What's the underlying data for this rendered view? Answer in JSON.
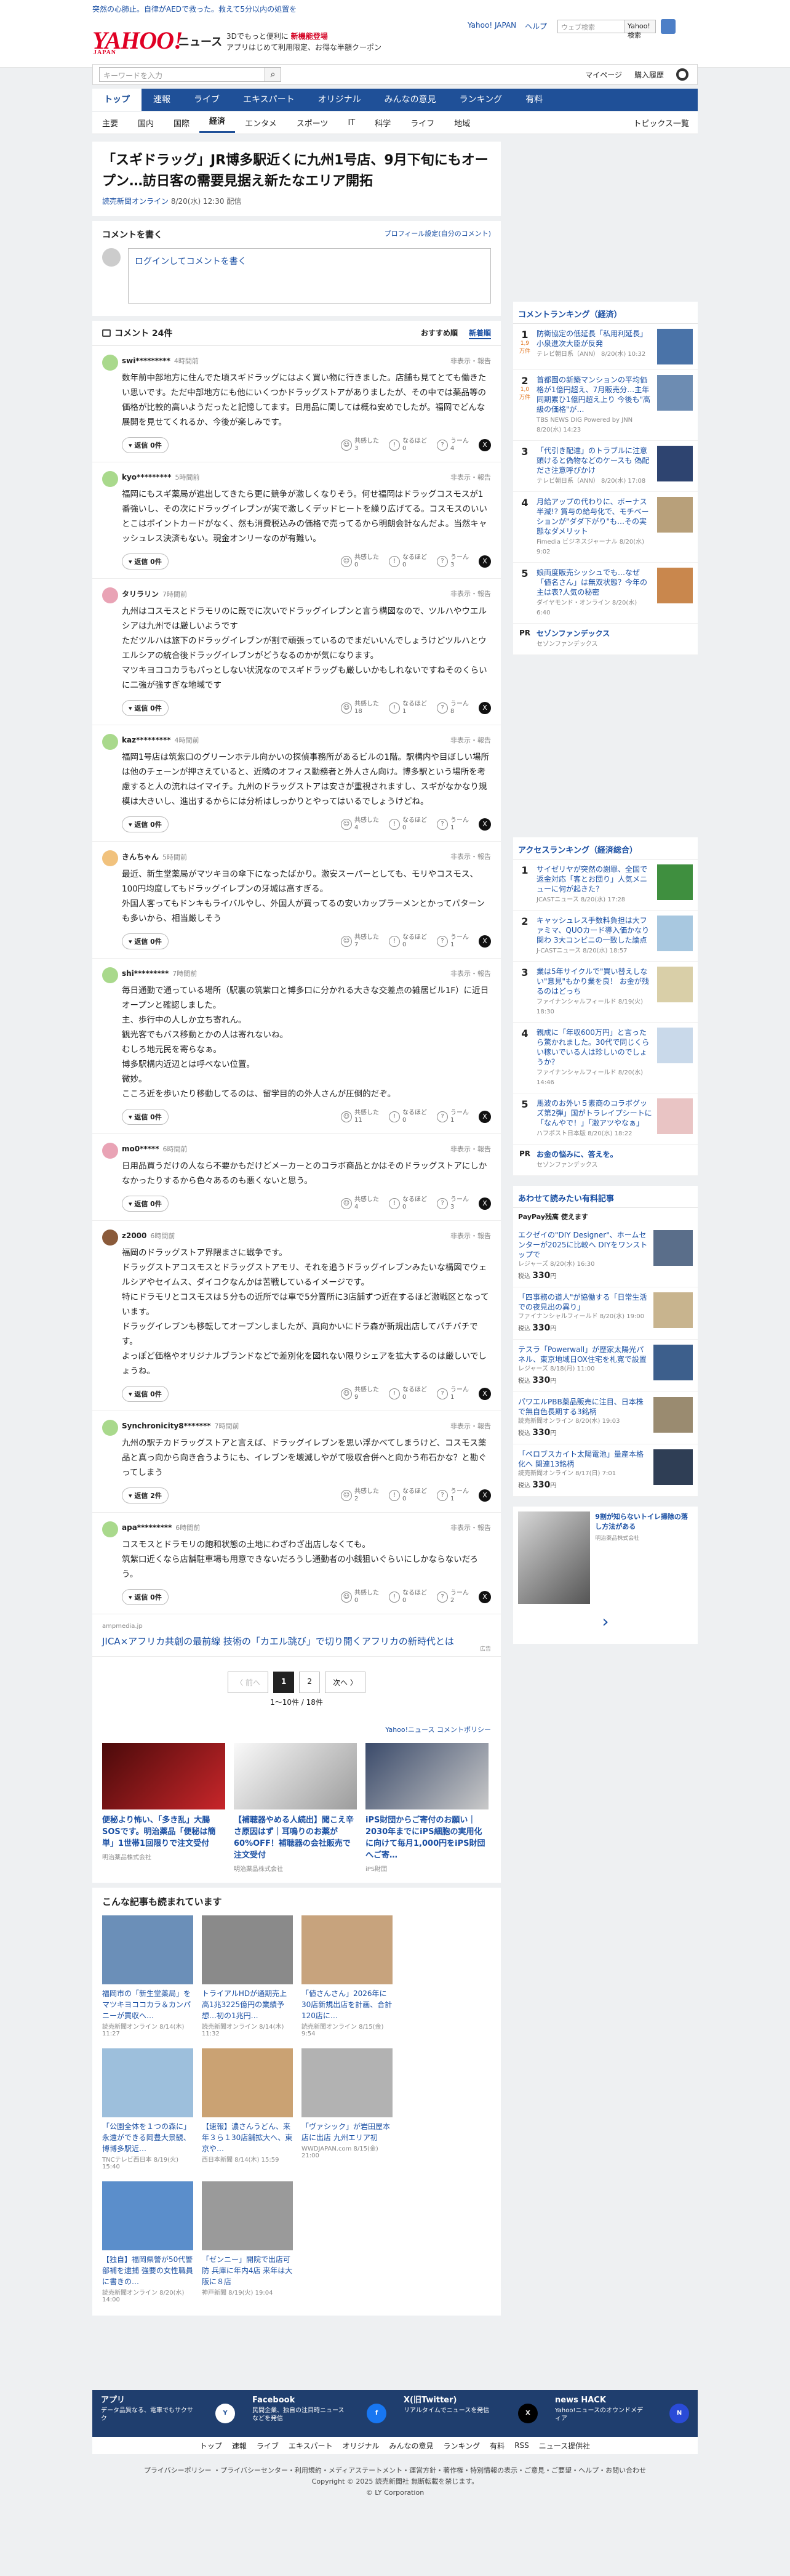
{
  "header": {
    "promo": "突然の心肺止。自律がAEDで救った。救えて5分以内の処置を",
    "logo": "YAHOO!",
    "logo_sub": "JAPAN",
    "logo_news": "ニュース",
    "tagline1": "3Dでもっと便利に",
    "tagline1b": "新機能登場",
    "tagline2": "アプリはじめて利用限定、お得な半額クーポン",
    "links": [
      "Yahoo! JAPAN",
      "ヘルプ"
    ],
    "search_placeholder": "ウェブ検索",
    "search_button": "Yahoo! 検索",
    "site_search_placeholder": "キーワードを入力",
    "mypage": "マイページ",
    "history": "購入履歴"
  },
  "nav": {
    "main": [
      "トップ",
      "速報",
      "ライブ",
      "エキスパート",
      "オリジナル",
      "みんなの意見",
      "ランキング",
      "有料"
    ],
    "active": 0,
    "sub": [
      "主要",
      "国内",
      "国際",
      "経済",
      "エンタメ",
      "スポーツ",
      "IT",
      "科学",
      "ライフ",
      "地域"
    ],
    "sub_active": 3,
    "sub_right": "トピックス一覧"
  },
  "article": {
    "title": "「スギドラッグ」JR博多駅近くに九州1号店、9月下旬にもオープン…訪日客の需要見据え新たなエリア開拓",
    "source": "読売新聞オンライン",
    "date": "8/20(水) 12:30 配信"
  },
  "comment_write": {
    "title": "コメントを書く",
    "profile_link": "プロフィール設定(自分のコメント)",
    "placeholder": "ログインしてコメントを書く"
  },
  "comments_header": {
    "count": "コメント 24件",
    "sort_recommend": "おすすめ順",
    "sort_new": "新着順"
  },
  "comments": [
    {
      "user": "swi*********",
      "time": "4時間前",
      "report": "非表示・報告",
      "avatar": "#a9d98c",
      "text": "数年前中部地方に住んでた頃スギドラッグにはよく買い物に行きました。店舗も見てとても働きたい思いです。ただ中部地方にも他にいくつかドラッグストアがありましたが、その中では薬品等の価格が比較的高いようだったと記憶してます。日用品に関しては概ね安めでしたが。福岡でどんな展開を見せてくれるか、今後が楽しみです。",
      "reply": "返信 0件",
      "v1": "3",
      "v2": "0",
      "v3": "4"
    },
    {
      "user": "kyo*********",
      "time": "5時間前",
      "report": "非表示・報告",
      "avatar": "#a9d98c",
      "text": "福岡にもスギ薬局が進出してきたら更に競争が激しくなりそう。何せ福岡はドラッグコスモスが1番強いし、その次にドラッグイレブンが実で激しくデッドヒートを繰り広げてる。コスモスのいいとこはポイントカードがなく、然も消費税込みの価格で売ってるから明朗会計なんだよ。当然キャッシュレス決済もない。現金オンリーなのが有難い。",
      "reply": "返信 0件",
      "v1": "0",
      "v2": "0",
      "v3": "3"
    },
    {
      "user": "タリラリン",
      "time": "7時間前",
      "report": "非表示・報告",
      "avatar": "#e9a3b5",
      "text": "九州はコスモスとドラモリのに既でに次いでドラッグイレブンと言う構図なので、ツルハやウエルシアは九州では厳しいようです\nただツルハは旅下のドラッグイレブンが割で頑張っているのでまだいいんでしょうけどツルハとウエルシアの統合後ドラッグイレブンがどうなるのかが気になります。\nマツキヨココカラもパっとしない状況なのでスギドラッグも厳しいかもしれないですねそのくらいに二強が強すぎな地域です",
      "reply": "返信 0件",
      "v1": "18",
      "v2": "1",
      "v3": "8"
    },
    {
      "user": "kaz*********",
      "time": "4時間前",
      "report": "非表示・報告",
      "avatar": "#a9d98c",
      "text": "福岡1号店は筑紫口のグリーンホテル向かいの探偵事務所があるビルの1階。駅構内や目ぼしい場所は他のチェーンが押さえていると、近隣のオフィス勤務者と外人さん向け。博多駅という場所を考慮すると人の流れはイマイチ。九州のドラッグストアは安さが重視されますし、スギがなかなり規模は大きいし、進出するからには分析はしっかりとやってはいるでしょうけどね。",
      "reply": "返信 0件",
      "v1": "4",
      "v2": "0",
      "v3": "1"
    },
    {
      "user": "きんちゃん",
      "time": "5時間前",
      "report": "非表示・報告",
      "avatar": "#f1c27d",
      "text": "最近、新生堂薬局がマツキヨの傘下になったばかり。激安スーパーとしても、モリやコスモス、100円均度してもドラッグイレブンの牙城は高すぎる。\n外国人客ってもドンキもライバルやし、外国人が買ってるの安いカップラーメンとかってパターンも多いから、相当厳しそう",
      "reply": "返信 0件",
      "v1": "7",
      "v2": "0",
      "v3": "1"
    },
    {
      "user": "shi*********",
      "time": "7時間前",
      "report": "非表示・報告",
      "avatar": "#a9d98c",
      "text": "毎日通勤で通っている場所（駅裏の筑紫口と博多口に分かれる大きな交差点の雑居ビル1F）に近日オープンと確認しました。\n主、歩行中の人しか立ち寄れん。\n観光客でもバス移動とかの人は寄れないね。\nむしろ地元民を寄らなぁ。\n博多駅構内近辺とは呼べない位置。\n微妙。\nこころ近を歩いたり移動してるのは、留学目的の外人さんが圧倒的だぞ。",
      "reply": "返信 0件",
      "v1": "11",
      "v2": "0",
      "v3": "1"
    },
    {
      "user": "mo0*****",
      "time": "6時間前",
      "report": "非表示・報告",
      "avatar": "#e9a3b5",
      "text": "日用品買うだけの人なら不要かもだけどメーカーとのコラボ商品とかはそのドラッグストアにしかなかったりするから色々あるのも悪くないと思う。",
      "reply": "返信 0件",
      "v1": "4",
      "v2": "0",
      "v3": "3"
    },
    {
      "user": "z2000",
      "time": "6時間前",
      "report": "非表示・報告",
      "avatar": "#8a5a3a",
      "text": "福岡のドラッグストア界隈まさに戦争です。\nドラッグストアコスモスとドラッグストアモリ、それを追うドラッグイレブンみたいな構図でウェルシアやセイムス、ダイコクなんかは苦戦しているイメージです。\n特にドラモリとコスモスは５分もの近所では車で5分置所に3店舗ずつ近在するほど激戦区となっています。\nドラッグイレブンも移転してオープンしましたが、真向かいにドラ森が新規出店してバチバチです。\nよっぽど価格やオリジナルブランドなどで差別化を図れない限りシェアを拡大するのは厳しいでしょうね。",
      "reply": "返信 0件",
      "v1": "9",
      "v2": "0",
      "v3": "1"
    },
    {
      "user": "Synchronicity8*******",
      "time": "7時間前",
      "report": "非表示・報告",
      "avatar": "#a9d98c",
      "text": "九州の駅チカドラッグストアと言えば、ドラッグイレブンを思い浮かべてしまうけど、コスモス薬品と真っ向から向き合うようにも、イレブンを壊滅しやがて吸収合併へと向かう布石かな？と勘ぐってしまう",
      "reply": "返信 2件",
      "v1": "2",
      "v2": "0",
      "v3": "1"
    },
    {
      "user": "apa*********",
      "time": "6時間前",
      "report": "非表示・報告",
      "avatar": "#a9d98c",
      "text": "コスモスとドラモリの飽和状態の土地にわざわざ出店しなくても。\n筑紫口近くなら店舗駐車場も用意できないだろうし通勤者の小銭狙いぐらいにしかならないだろう。",
      "reply": "返信 0件",
      "v1": "0",
      "v2": "0",
      "v3": "2"
    }
  ],
  "comment_ad": {
    "domain": "ampmedia.jp",
    "text": "JICA×アフリカ共創の最前線 技術の「カエル跳び」で切り開くアフリカの新時代とは",
    "label": "広告"
  },
  "pagination": {
    "prev": "〈 前へ",
    "pages": [
      "1",
      "2"
    ],
    "next": "次へ 〉",
    "count": "1〜10件 / 18件"
  },
  "policy": "Yahoo!ニュース コメントポリシー",
  "sponsored": [
    {
      "title": "便秘より怖い、「多き乱」大腸SOSです。明治薬品「便秘は簡単」1世帯1回限りで注文受付",
      "source": "明治薬品株式会社"
    },
    {
      "title": "【補聴器やめる人続出】聞こえ辛さ原因はず｜耳鳴りのお薬が60%OFF！補聴器の会社販売で注文受付",
      "source": "明治薬品株式会社"
    },
    {
      "title": "iPS財団からご寄付のお願い｜2030年までにiPS細胞の実用化に向けて毎月1,000円をiPS財団へご寄…",
      "source": "iPS財団"
    }
  ],
  "recommend": {
    "title": "こんな記事も読まれています",
    "items": [
      {
        "title": "福岡市の「新生堂薬局」をマツキヨココカラ＆カンパニーが買収へ…",
        "source": "読売新聞オンライン",
        "date": "8/14(木) 11:27"
      },
      {
        "title": "トライアルHDが通期売上高1兆3225億円の業績予想…初の1兆円…",
        "source": "読売新聞オンライン",
        "date": "8/14(木) 11:32"
      },
      {
        "title": "「値さんさん」2026年に30店新規出店を計画、合計120店に…",
        "source": "読売新聞オンライン",
        "date": "8/15(金) 9:54"
      },
      {
        "title": "「公園全体を１つの森に」永遠ができる岡豊大景観、博博多駅近…",
        "source": "TNCテレビ西日本",
        "date": "8/19(火) 15:40"
      },
      {
        "title": "【速報】濃さんうどん、来年３ら１30店舗拡大へ、東京や…",
        "source": "西日本新聞",
        "date": "8/14(木) 15:59"
      },
      {
        "title": "「ヴァシック」が岩田屋本店に出店 九州エリア初",
        "source": "WWDJAPAN.com",
        "date": "8/15(金) 21:00"
      },
      {
        "title": "【独自】福岡県警が50代警部補を逮捕 強要の女性職員に書きの…",
        "source": "読売新聞オンライン",
        "date": "8/20(水) 14:00"
      },
      {
        "title": "「ゼンニー」開院で出店可防 兵庫に年内4店 来年は大阪に８店",
        "source": "神戸新聞",
        "date": "8/19(火) 19:04"
      }
    ]
  },
  "side_comment_ranking": {
    "title": "コメントランキング（経済）",
    "items": [
      {
        "rank": "1",
        "count": "1,9万件",
        "title": "防衛協定の低延長「私用利延長」小泉進次大臣が反発",
        "source": "テレビ朝日系（ANN）",
        "date": "8/20(水) 10:32"
      },
      {
        "rank": "2",
        "count": "1,0万件",
        "title": "首都圏の新築マンションの平均価格が1億円超え、7月販売分…主年同期累ひ1億円超え上り 今後も\"高級の価格\"が…",
        "source": "TBS NEWS DIG Powered by JNN",
        "date": "8/20(水) 14:23"
      },
      {
        "rank": "3",
        "count": "",
        "title": "「代引き配達」のトラブルに注意 頭けると偽物などのケースも 偽配ださ注意呼びかけ",
        "source": "テレビ朝日系（ANN）",
        "date": "8/20(水) 17:08"
      },
      {
        "rank": "4",
        "count": "",
        "title": "月給アップの代わりに、ボーナス半減!? 賞与の給与化で、モチベーションが\"ダダ下がり\"も…その実態なダメリット",
        "source": "Fimedia ビジネスジャーナル",
        "date": "8/20(水) 9:02"
      },
      {
        "rank": "5",
        "count": "",
        "title": "娘両度販売シッシュでも…なぜ「値名さん」は無双状態？今年の主は表?人気の秘密",
        "source": "ダイヤモンド・オンライン",
        "date": "8/20(水) 6:40"
      }
    ],
    "pr_title": "セゾンファンデックス",
    "pr_source": "セゾンファンデックス"
  },
  "side_access_ranking": {
    "title": "アクセスランキング（経済総合）",
    "items": [
      {
        "rank": "1",
        "title": "サイゼリヤが突然の謝罪、全国で返金対応「客とお団り」人気メニューに何が起きた？",
        "source": "JCASTニュース",
        "date": "8/20(水) 17:28"
      },
      {
        "rank": "2",
        "title": "キャッシュレス手数料負担は大ファミマ、QUOカード導入価かなり関わ 3大コンビニの一致した論点",
        "source": "J-CASTニュース",
        "date": "8/20(水) 18:57"
      },
      {
        "rank": "3",
        "title": "業は5年サイクルで\"買い替えしない\"意見\"もかり業を良！ お金が残るのはどっち",
        "source": "ファイナンシャルフィールド",
        "date": "8/19(火) 18:30"
      },
      {
        "rank": "4",
        "title": "親成に「年収600万円」と言ったら驚かれました。30代で同じくらい稼いでいる人は珍しいのでしょうか？",
        "source": "ファイナンシャルフィールド",
        "date": "8/20(水) 14:46"
      },
      {
        "rank": "5",
        "title": "馬波のお外い５素商のコラボグッズ第2弾」国がトラレイプシートに「なんやで！」「激アツやなぁ」",
        "source": "ハフポスト日本版",
        "date": "8/20(水) 18:22"
      }
    ],
    "pr_title": "お金の悩みに、答えを。",
    "pr_source": "セゾンファンデックス"
  },
  "side_paid": {
    "title": "あわせて読みたい有料記事",
    "badge": "PayPay残高 使えます",
    "items": [
      {
        "title": "エクゼイの\"DIY Designer\"、ホームセンターが2025に比較へ DIYをワンストップで",
        "source": "レジャーズ 8/20(水) 16:30",
        "price": "330",
        "unit": "税込"
      },
      {
        "title": "「四事務の道人\"が協働する「日常生活での夜見出の異り」",
        "source": "ファイナンシャルフィールド 8/20(水) 19:00",
        "price": "330",
        "unit": "税込"
      },
      {
        "title": "テスラ「Powerwall」が歴家太陽光パネル、東京地域日OX住宅を札寛で設置",
        "source": "レジャーズ 8/18(月) 11:00",
        "price": "330",
        "unit": "税込"
      },
      {
        "title": "パワエルPBB薬品販売に注目、日本株で無自色長期する3銘柄",
        "source": "読売新聞オンライン 8/20(水) 19:03",
        "price": "330",
        "unit": "税込"
      },
      {
        "title": "「ペロブスカイト太陽電池」量産本格化へ 関連13銘柄",
        "source": "読売新聞オンライン 8/17(日) 7:01",
        "price": "330",
        "unit": "税込"
      }
    ]
  },
  "side_ad": {
    "title": "9割が知らないトイレ掃除の落し方法がある",
    "source": "明治薬品株式会社"
  },
  "footer": {
    "items": [
      {
        "title": "アプリ",
        "desc": "データ品質なる、電車でもサクサク",
        "icon": "Y"
      },
      {
        "title": "Facebook",
        "desc": "民間企業、独自の注目時ニュースなどを発信",
        "icon": "f"
      },
      {
        "title": "X(旧Twitter)",
        "desc": "リアルタイムでニュースを発信",
        "icon": "X"
      },
      {
        "title": "news HACK",
        "desc": "Yahoo!ニュースのオウンドメディア",
        "icon": "N"
      }
    ],
    "nav": [
      "トップ",
      "速報",
      "ライブ",
      "エキスパート",
      "オリジナル",
      "みんなの意見",
      "ランキング",
      "有料",
      "RSS",
      "ニュース提供社"
    ],
    "links": "プライバシーポリシー ・プライバシーセンター・利用規約・メディアステートメント・運営方針・著作権・特別情報の表示・ご意見・ご要望・ヘルプ・お問い合わせ",
    "copyright1": "Copyright © 2025 読売新聞社 無断転載を禁じます。",
    "copyright2": "© LY Corporation"
  }
}
